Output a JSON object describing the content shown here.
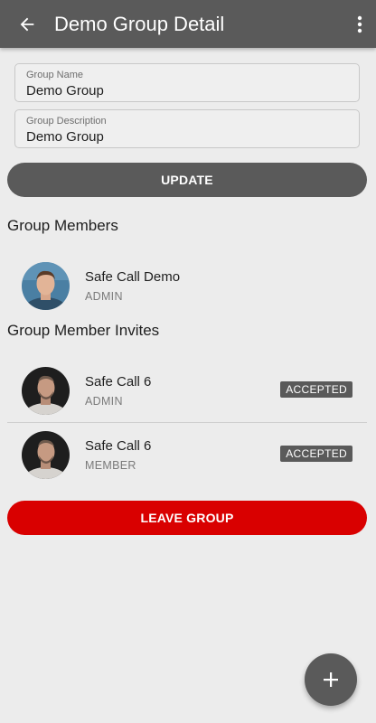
{
  "appbar": {
    "title": "Demo Group Detail",
    "back_icon": "arrow-left-icon",
    "more_icon": "more-vert-icon"
  },
  "form": {
    "name_label": "Group Name",
    "name_value": "Demo Group",
    "description_label": "Group Description",
    "description_value": "Demo Group",
    "update_label": "UPDATE"
  },
  "members": {
    "title": "Group Members",
    "items": [
      {
        "name": "Safe Call Demo",
        "role": "ADMIN"
      }
    ]
  },
  "invites": {
    "title": "Group Member Invites",
    "items": [
      {
        "name": "Safe Call 6",
        "role": "ADMIN",
        "status": "ACCEPTED"
      },
      {
        "name": "Safe Call 6",
        "role": "MEMBER",
        "status": "ACCEPTED"
      }
    ]
  },
  "leave_label": "LEAVE GROUP",
  "fab_icon": "plus-icon",
  "colors": {
    "appbar": "#5a5a5a",
    "leave": "#d90000",
    "background": "#ececec"
  }
}
